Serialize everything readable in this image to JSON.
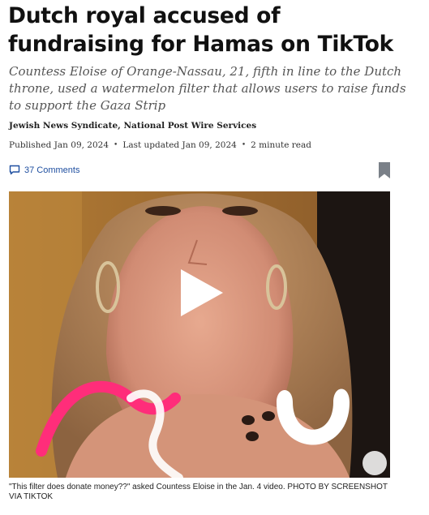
{
  "article": {
    "headline": "Dutch royal accused of fundraising for Hamas on TikTok",
    "dek": "Countess Eloise of Orange-Nassau, 21, fifth in line to the Dutch throne, used a watermelon filter that allows users to raise funds to support the Gaza Strip",
    "byline": "Jewish News Syndicate, National Post Wire Services",
    "meta": {
      "published": "Published Jan 09, 2024",
      "updated": "Last updated Jan 09, 2024",
      "read_time": "2 minute read",
      "separator": "•"
    },
    "comments_label": "37 Comments",
    "caption": "\"This filter does donate money??\" asked Countess Eloise in the Jan. 4 video. PHOTO BY SCREENSHOT VIA TIKTOK"
  },
  "colors": {
    "link": "#1f4fa0",
    "bookmark": "#7a8088",
    "filter_pink": "#ff2d7a"
  },
  "icons": {
    "comment": "comment-icon",
    "bookmark": "bookmark-icon",
    "play": "play-icon"
  }
}
